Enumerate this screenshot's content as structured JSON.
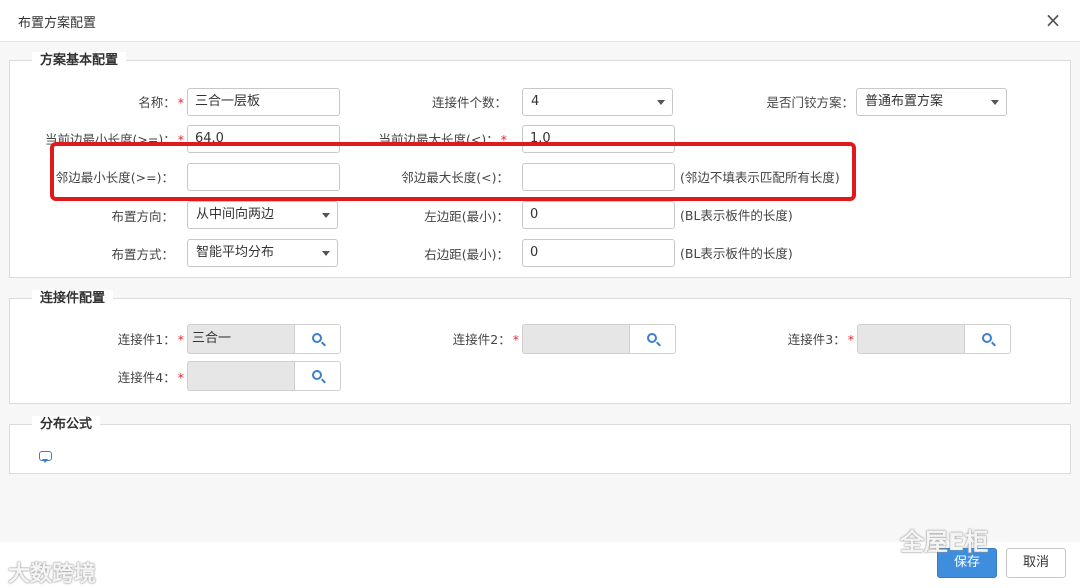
{
  "dialog": {
    "title": "布置方案配置",
    "close": "×"
  },
  "basic": {
    "legend": "方案基本配置",
    "name_label": "名称：",
    "name_value": "三合一层板",
    "connector_count_label": "连接件个数：",
    "connector_count_value": "4",
    "door_hinge_label": "是否门铰方案：",
    "door_hinge_value": "普通布置方案",
    "cur_min_label": "当前边最小长度(>=)：",
    "cur_min_value": "64.0",
    "cur_max_label": "当前边最大长度(<)：",
    "cur_max_value": "1.0",
    "adj_min_label": "邻边最小长度(>=)：",
    "adj_min_value": "",
    "adj_max_label": "邻边最大长度(<)：",
    "adj_max_value": "",
    "adj_hint": "(邻边不填表示匹配所有长度)",
    "direction_label": "布置方向：",
    "direction_value": "从中间向两边",
    "left_margin_label": "左边距(最小)：",
    "left_margin_value": "0",
    "left_margin_hint": "(BL表示板件的长度)",
    "method_label": "布置方式：",
    "method_value": "智能平均分布",
    "right_margin_label": "右边距(最小)：",
    "right_margin_value": "0",
    "right_margin_hint": "(BL表示板件的长度)",
    "required_mark": "*"
  },
  "connectors": {
    "legend": "连接件配置",
    "items": [
      {
        "label": "连接件1：",
        "value": "三合一"
      },
      {
        "label": "连接件2：",
        "value": ""
      },
      {
        "label": "连接件3：",
        "value": ""
      },
      {
        "label": "连接件4：",
        "value": ""
      }
    ]
  },
  "formula": {
    "legend": "分布公式"
  },
  "footer": {
    "save": "保存",
    "cancel": "取消"
  },
  "watermarks": {
    "left": "大数跨境",
    "right": "全屋E柜"
  },
  "colors": {
    "accent": "#3e8edd",
    "highlight": "#e0191d",
    "required": "#ee2233"
  }
}
